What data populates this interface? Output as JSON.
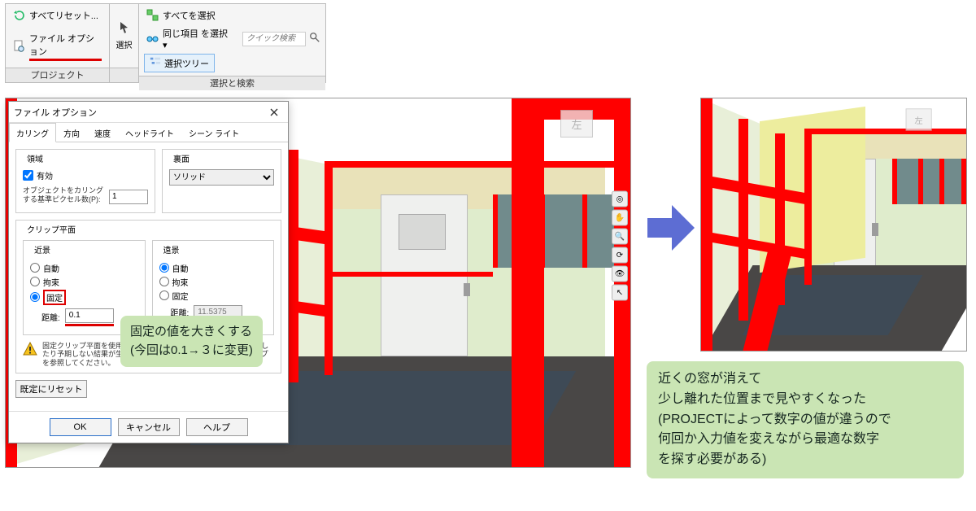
{
  "ribbon": {
    "g1": {
      "resetAll": "すべてリセット...",
      "fileOptions": "ファイル オプション",
      "label": "プロジェクト"
    },
    "g2": {
      "select": "選択"
    },
    "g3": {
      "selectAll": "すべてを選択",
      "selectSame": "同じ項目 を選択 ▾",
      "quickSearchPlaceholder": "クイック検索",
      "selectionTree": "選択ツリー",
      "label": "選択と検索"
    }
  },
  "dialog": {
    "title": "ファイル オプション",
    "tabs": [
      "カリング",
      "方向",
      "速度",
      "ヘッドライト",
      "シーン ライト"
    ],
    "region": {
      "legend": "領域",
      "enable": "有効",
      "pixelCull": "オブジェクトをカリングする基準ピクセル数(P):",
      "pixelValue": "1"
    },
    "backface": {
      "legend": "裏面",
      "solid": "ソリッド"
    },
    "clip": {
      "legend": "クリップ平面",
      "near": {
        "legend": "近景",
        "auto": "自動",
        "constrain": "拘束",
        "fixed": "固定",
        "distance": "距離:",
        "distValue": "0.1"
      },
      "far": {
        "legend": "遠景",
        "auto": "自動",
        "constrain": "拘束",
        "fixed": "固定",
        "distance": "距離:",
        "distValue": "11.5375"
      }
    },
    "warning": "固定クリップ平面を使用すると、システムのパフォーマンスが低下したり予期しない結果が生じることがあります。詳細についてはヘルプを参照してください。",
    "resetBtn": "既定にリセット",
    "ok": "OK",
    "cancel": "キャンセル",
    "help": "ヘルプ"
  },
  "callout1": {
    "line1": "固定の値を大きくする",
    "line2": "(今回は0.1→３に変更)"
  },
  "callout2": {
    "l1": "近くの窓が消えて",
    "l2": "少し離れた位置まで見やすくなった",
    "l3": "(PROJECTによって数字の値が違うので",
    "l4": "何回か入力値を変えながら最適な数字",
    "l5": "を探す必要がある)"
  },
  "viewcube": {
    "face": "左"
  }
}
